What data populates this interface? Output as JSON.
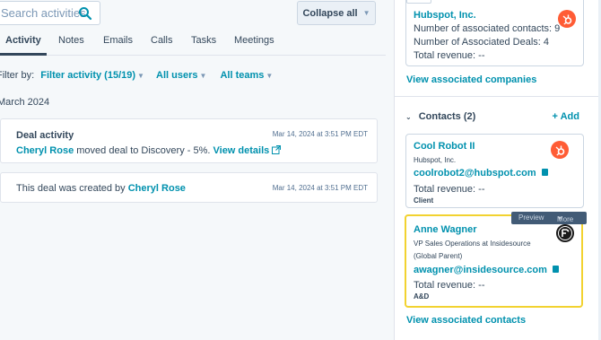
{
  "search": {
    "placeholder": "Search activities"
  },
  "toolbar": {
    "collapse_label": "Collapse all"
  },
  "tabs": [
    {
      "label": "Activity"
    },
    {
      "label": "Notes"
    },
    {
      "label": "Emails"
    },
    {
      "label": "Calls"
    },
    {
      "label": "Tasks"
    },
    {
      "label": "Meetings"
    }
  ],
  "filters": {
    "label": "Filter by:",
    "activity": "Filter activity (15/19)",
    "users": "All users",
    "teams": "All teams"
  },
  "timeline": {
    "month": "March 2024",
    "cards": [
      {
        "title": "Deal activity",
        "actor": "Cheryl Rose",
        "text": "moved deal to Discovery - 5%.",
        "link": "View details",
        "timestamp": "Mar 14, 2024 at 3:51 PM EDT"
      },
      {
        "prefix": "This deal was created by",
        "actor": "Cheryl Rose",
        "timestamp": "Mar 14, 2024 at 3:51 PM EDT"
      }
    ]
  },
  "company": {
    "name": "Hubspot, Inc.",
    "contacts_line": "Number of associated contacts: 9",
    "deals_line": "Number of Associated Deals: 4",
    "revenue_line": "Total revenue: --",
    "view_link": "View associated companies"
  },
  "contacts": {
    "header": "Contacts (2)",
    "add_label": "+ Add",
    "items": [
      {
        "name": "Cool Robot II",
        "company": "Hubspot, Inc.",
        "email": "coolrobot2@hubspot.com",
        "revenue": "Total revenue: --",
        "tag": "Client"
      },
      {
        "name": "Anne Wagner",
        "title1": "VP Sales Operations at Insidesource",
        "title2": "(Global Parent)",
        "email": "awagner@insidesource.com",
        "revenue": "Total revenue: --",
        "tag": "A&D"
      }
    ],
    "hover": {
      "preview": "Preview",
      "more": "More"
    },
    "view_link": "View associated contacts"
  },
  "colors": {
    "accent": "#0091ae",
    "brand": "#ff5c35",
    "highlight": "#f2d230"
  }
}
